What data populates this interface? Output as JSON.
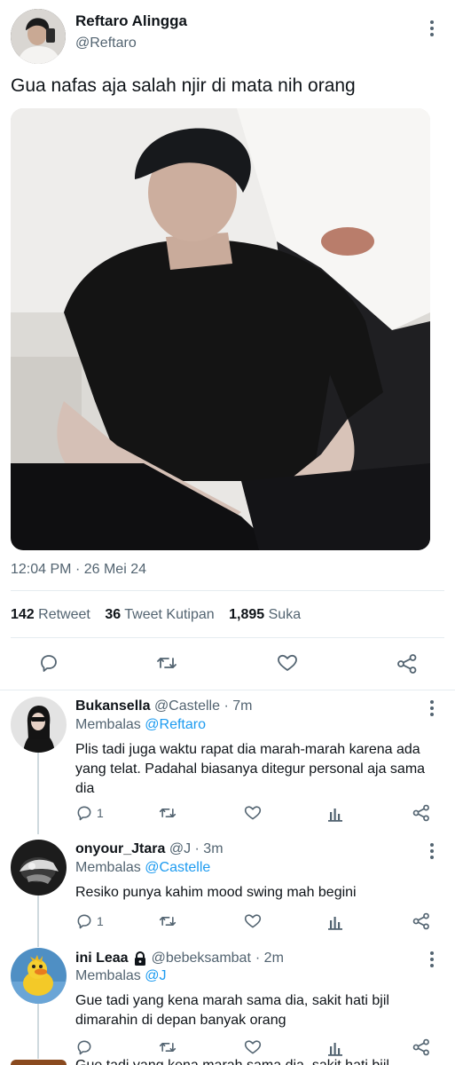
{
  "tweet": {
    "author_name": "Reftaro Alingga",
    "author_handle": "@Reftaro",
    "text": "Gua nafas aja salah njir di mata nih orang",
    "time": "12:04 PM",
    "separator": "·",
    "date": "26 Mei 24",
    "stats": {
      "retweets_count": "142",
      "retweets_label": "Retweet",
      "quotes_count": "36",
      "quotes_label": "Tweet Kutipan",
      "likes_count": "1,895",
      "likes_label": "Suka"
    }
  },
  "replies": [
    {
      "name": "Bukansella",
      "handle": "@Castelle",
      "time": "· 7m",
      "reply_to_prefix": "Membalas",
      "reply_to_handle": "@Reftaro",
      "text": "Plis tadi juga waktu rapat dia marah-marah karena ada yang telat. Padahal biasanya ditegur personal aja sama dia",
      "reply_count": "1",
      "retweet_count": "",
      "like_count": ""
    },
    {
      "name": "onyour_Jtara",
      "handle": "@J",
      "time": "· 3m",
      "reply_to_prefix": "Membalas",
      "reply_to_handle": "@Castelle",
      "text": "Resiko punya kahim mood swing mah begini",
      "reply_count": "1",
      "retweet_count": "",
      "like_count": ""
    },
    {
      "name": "ini Leaa",
      "handle": "@bebeksambat",
      "time": "· 2m",
      "reply_to_prefix": "Membalas",
      "reply_to_handle": "@J",
      "text": "Gue tadi yang kena marah sama dia, sakit hati bjil dimarahin di depan banyak orang",
      "reply_count": "",
      "retweet_count": "",
      "like_count": ""
    }
  ],
  "partial_reply_text": "Gue tadi yang kena marah sama dia, sakit hati bjil",
  "icons": {
    "reply": "reply-icon",
    "retweet": "retweet-icon",
    "like": "heart-icon",
    "analytics": "analytics-icon",
    "share": "share-icon",
    "more": "more-icon",
    "lock": "lock-icon"
  },
  "colors": {
    "text_primary": "#0f1419",
    "text_secondary": "#536471",
    "accent": "#1d9bf0",
    "divider": "#e6ecf0"
  }
}
